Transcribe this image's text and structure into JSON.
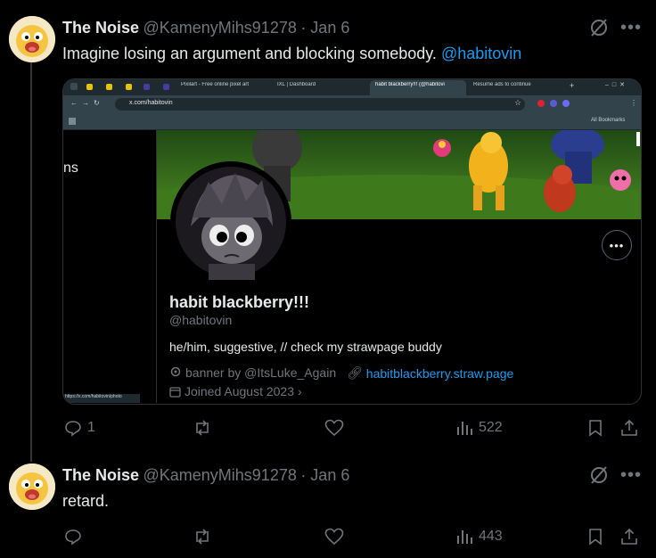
{
  "tweet1": {
    "name": "The Noise",
    "handle": "@KamenyMihs91278",
    "date": "· Jan 6",
    "text": "Imagine losing an argument and blocking somebody.",
    "mention": "@habitovin",
    "replies": "1",
    "views": "522"
  },
  "embed": {
    "tabs": [
      "Pixilart - Free online pixel art",
      "IXL | Dashboard",
      "habit blackberry!!! (@habitovi",
      "Resume ads to continue"
    ],
    "url": "x.com/habitovin",
    "bookmarks": "All Bookmarks",
    "sidebar_fragment": "ns",
    "profile_name": "habit blackberry!!!",
    "profile_handle": "@habitovin",
    "bio": "he/him, suggestive, // check my strawpage buddy",
    "banner_credit": "banner by @ItsLuke_Again",
    "link": "habitblackberry.straw.page",
    "joined": "Joined August 2023",
    "status_url": "https://x.com/habitovin/photo"
  },
  "tweet2": {
    "name": "The Noise",
    "handle": "@KamenyMihs91278",
    "date": "· Jan 6",
    "text": "retard.",
    "views": "443"
  }
}
